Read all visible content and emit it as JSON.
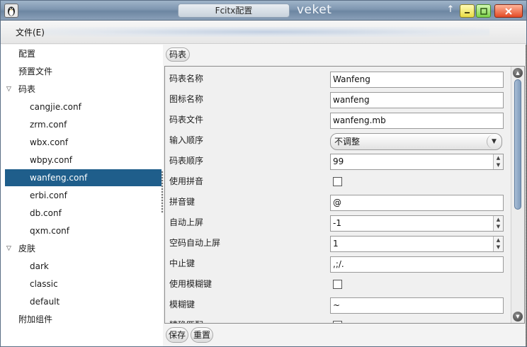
{
  "window": {
    "title": "Fcitx配置",
    "brand": "veket"
  },
  "menubar": {
    "file": "文件(E)"
  },
  "sidebar": {
    "items": [
      {
        "label": "配置",
        "depth": 0,
        "expander": ""
      },
      {
        "label": "预置文件",
        "depth": 0,
        "expander": ""
      },
      {
        "label": "码表",
        "depth": 0,
        "expander": "▽"
      },
      {
        "label": "cangjie.conf",
        "depth": 1,
        "expander": ""
      },
      {
        "label": "zrm.conf",
        "depth": 1,
        "expander": ""
      },
      {
        "label": "wbx.conf",
        "depth": 1,
        "expander": ""
      },
      {
        "label": "wbpy.conf",
        "depth": 1,
        "expander": ""
      },
      {
        "label": "wanfeng.conf",
        "depth": 1,
        "expander": "",
        "selected": true
      },
      {
        "label": "erbi.conf",
        "depth": 1,
        "expander": ""
      },
      {
        "label": "db.conf",
        "depth": 1,
        "expander": ""
      },
      {
        "label": "qxm.conf",
        "depth": 1,
        "expander": ""
      },
      {
        "label": "皮肤",
        "depth": 0,
        "expander": "▽"
      },
      {
        "label": "dark",
        "depth": 1,
        "expander": ""
      },
      {
        "label": "classic",
        "depth": 1,
        "expander": ""
      },
      {
        "label": "default",
        "depth": 1,
        "expander": ""
      },
      {
        "label": "附加组件",
        "depth": 0,
        "expander": ""
      }
    ]
  },
  "content": {
    "tab": "码表",
    "rows": [
      {
        "label": "码表名称",
        "type": "text",
        "value": "Wanfeng"
      },
      {
        "label": "图标名称",
        "type": "text",
        "value": "wanfeng"
      },
      {
        "label": "码表文件",
        "type": "text",
        "value": "wanfeng.mb"
      },
      {
        "label": "输入顺序",
        "type": "combo",
        "value": "不调整"
      },
      {
        "label": "码表顺序",
        "type": "spin",
        "value": "99"
      },
      {
        "label": "使用拼音",
        "type": "check",
        "value": ""
      },
      {
        "label": "拼音键",
        "type": "text",
        "value": "@"
      },
      {
        "label": "自动上屏",
        "type": "spin",
        "value": "-1"
      },
      {
        "label": "空码自动上屏",
        "type": "spin",
        "value": "1"
      },
      {
        "label": "中止键",
        "type": "text",
        "value": ",;/."
      },
      {
        "label": "使用模糊键",
        "type": "check",
        "value": ""
      },
      {
        "label": "模糊键",
        "type": "text",
        "value": "~"
      },
      {
        "label": "精确匹配",
        "type": "check",
        "value": ""
      }
    ]
  },
  "footer": {
    "save": "保存",
    "reset": "重置"
  },
  "icons": {
    "app": "penguin-icon",
    "pin": "pin-icon",
    "minimize": "minimize-icon",
    "maximize": "maximize-icon",
    "close": "close-icon"
  },
  "colors": {
    "selection": "#1f5e8b",
    "titlebar": "#7e96b0",
    "scroll_thumb": "#7f9bbb"
  }
}
